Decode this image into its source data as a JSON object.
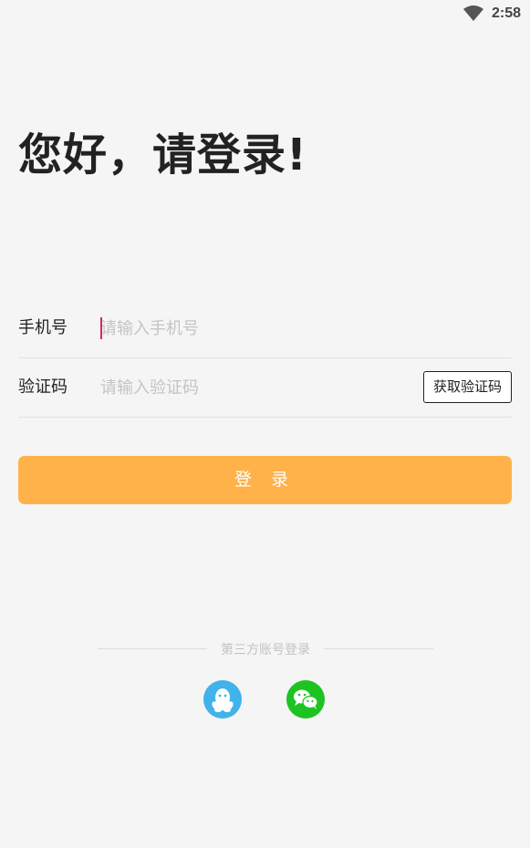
{
  "status_bar": {
    "time": "2:58",
    "icons": [
      "wifi-icon"
    ]
  },
  "greeting": "您好，请登录!",
  "form": {
    "phone": {
      "label": "手机号",
      "placeholder": "请输入手机号",
      "value": ""
    },
    "code": {
      "label": "验证码",
      "placeholder": "请输入验证码",
      "value": "",
      "get_code_label": "获取验证码"
    },
    "submit_label": "登 录"
  },
  "third_party": {
    "title": "第三方账号登录",
    "providers": [
      {
        "name": "qq",
        "icon": "qq-penguin-icon",
        "color": "#3fb3ea"
      },
      {
        "name": "wechat",
        "icon": "wechat-bubbles-icon",
        "color": "#1ec322"
      }
    ]
  },
  "colors": {
    "background": "#f5f5f5",
    "accent": "#ffb24a",
    "caret": "#d8265a"
  }
}
